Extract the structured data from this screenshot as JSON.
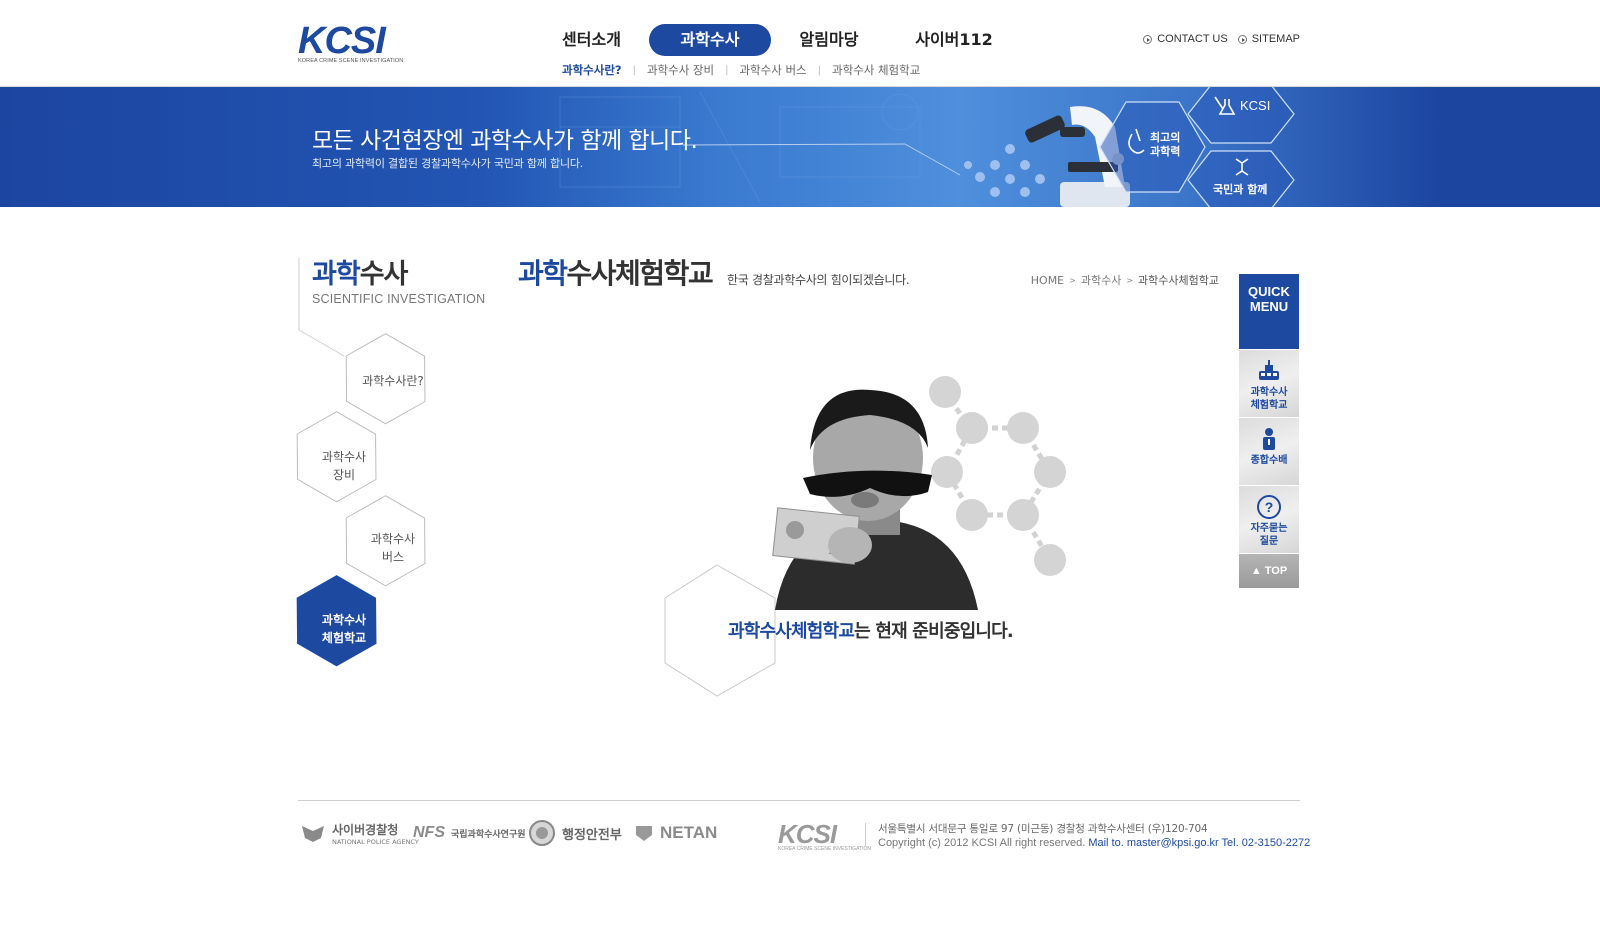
{
  "header": {
    "logo_text": "KCSI",
    "logo_tagline": "KOREA CRIME SCENE INVESTIGATION",
    "gnb": [
      {
        "label": "센터소개",
        "active": false
      },
      {
        "label": "과학수사",
        "active": true
      },
      {
        "label": "알림마당",
        "active": false
      },
      {
        "label": "사이버112",
        "active": false
      }
    ],
    "util_links": [
      "CONTACT US",
      "SITEMAP"
    ],
    "sub_gnb": [
      "과학수사란?",
      "과학수사 장비",
      "과학수사 버스",
      "과학수사 체험학교"
    ],
    "sub_gnb_sep": "|"
  },
  "banner": {
    "title": "모든 사건현장엔 과학수사가 함께 합니다.",
    "subtitle": "최고의 과학력이 결합된 경찰과학수사가 국민과 함께 합니다.",
    "hex_kcsi": "KCSI",
    "hex_science_1": "최고의",
    "hex_science_2": "과학력",
    "hex_people": "국민과 함께"
  },
  "lnb": {
    "title_blue": "과학",
    "title_rest": "수사",
    "title_eng": "SCIENTIFIC INVESTIGATION",
    "items": [
      {
        "line1": "과학수사란?",
        "line2": "",
        "active": false
      },
      {
        "line1": "과학수사",
        "line2": "장비",
        "active": false
      },
      {
        "line1": "과학수사",
        "line2": "버스",
        "active": false
      },
      {
        "line1": "과학수사",
        "line2": "체험학교",
        "active": true
      }
    ]
  },
  "content": {
    "title_blue": "과학",
    "title_rest": "수사체험학교",
    "description": "한국 경찰과학수사의 힘이되겠습니다.",
    "breadcrumb": [
      "HOME",
      "과학수사",
      "과학수사체험학교"
    ],
    "breadcrumb_sep": ">",
    "ready_blue": "과학수사체험학교",
    "ready_rest": "는 현재 준비중입니다.",
    "banknote_text": "10000"
  },
  "quick_menu": {
    "title_1": "QUICK",
    "title_2": "MENU",
    "items": [
      {
        "line1": "과학수사",
        "line2": "체험학교",
        "icon": "bus-icon"
      },
      {
        "line1": "종합수배",
        "line2": "",
        "icon": "wanted-person-icon"
      },
      {
        "line1": "자주묻는",
        "line2": "질문",
        "icon": "question-icon"
      }
    ],
    "top_label": "▲ TOP"
  },
  "footer": {
    "partner_1": "사이버경찰청",
    "partner_1_sub": "NATIONAL POLICE AGENCY",
    "partner_2_mark": "NFS",
    "partner_2": "국립과학수사연구원",
    "partner_3": "행정안전부",
    "partner_4": "NETAN",
    "logo_text": "KCSI",
    "logo_tagline": "KOREA CRIME SCENE INVESTIGATION",
    "address": "서울특별시 서대문구 통일로 97 (미근동) 경찰청 과학수사센터 (우)120-704",
    "copyright": "Copyright (c) 2012 KCSI All right reserved.",
    "contact": "Mail to. master@kpsi.go.kr Tel. 02-3150-2272"
  },
  "colors": {
    "brand_blue": "#1d4aa0",
    "accent_light_blue": "#3a8fd8",
    "gray_hex": "#d0d0d0"
  }
}
